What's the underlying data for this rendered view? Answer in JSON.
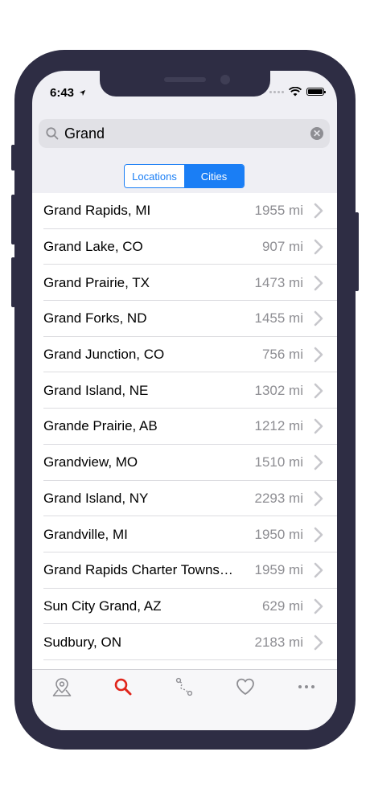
{
  "status": {
    "time": "6:43"
  },
  "search": {
    "query": "Grand"
  },
  "segments": [
    {
      "label": "Locations",
      "selected": false
    },
    {
      "label": "Cities",
      "selected": true
    }
  ],
  "results": [
    {
      "name": "Grand Rapids, MI",
      "distance": "1955 mi"
    },
    {
      "name": "Grand Lake, CO",
      "distance": "907 mi"
    },
    {
      "name": "Grand Prairie, TX",
      "distance": "1473 mi"
    },
    {
      "name": "Grand Forks, ND",
      "distance": "1455 mi"
    },
    {
      "name": "Grand Junction, CO",
      "distance": "756 mi"
    },
    {
      "name": "Grand Island, NE",
      "distance": "1302 mi"
    },
    {
      "name": "Grande Prairie, AB",
      "distance": "1212 mi"
    },
    {
      "name": "Grandview, MO",
      "distance": "1510 mi"
    },
    {
      "name": "Grand Island, NY",
      "distance": "2293 mi"
    },
    {
      "name": "Grandville, MI",
      "distance": "1950 mi"
    },
    {
      "name": "Grand Rapids Charter Towns…",
      "distance": "1959 mi"
    },
    {
      "name": "Sun City Grand, AZ",
      "distance": "629 mi"
    },
    {
      "name": "Sudbury, ON",
      "distance": "2183 mi"
    },
    {
      "name": "",
      "distance": ""
    }
  ],
  "tabs": [
    {
      "icon": "map-pin-icon",
      "selected": false
    },
    {
      "icon": "search-icon",
      "selected": true
    },
    {
      "icon": "route-icon",
      "selected": false
    },
    {
      "icon": "heart-icon",
      "selected": false
    },
    {
      "icon": "more-icon",
      "selected": false
    }
  ],
  "colors": {
    "accent": "#1a7ef5",
    "tab_selected": "#e0251b",
    "tab_unselected": "#8e8e93",
    "frame": "#2e2d44"
  }
}
